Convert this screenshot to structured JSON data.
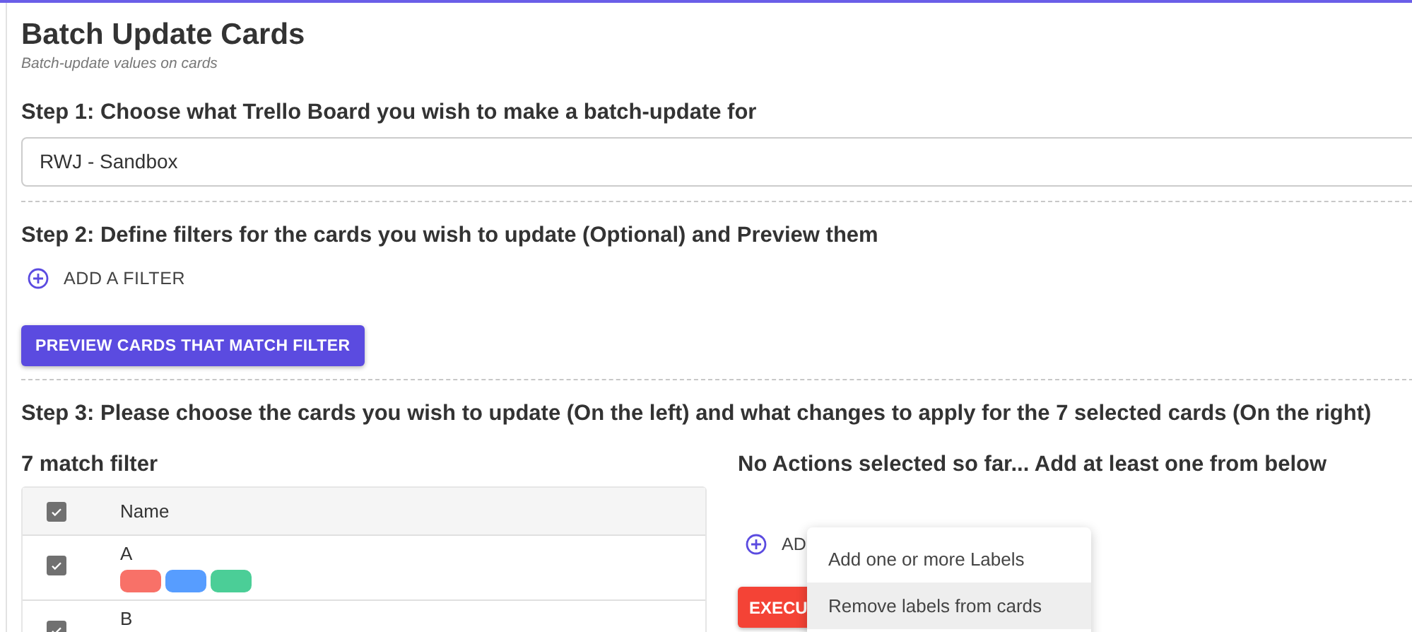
{
  "title": "Batch Update Cards",
  "subtitle": "Batch-update values on cards",
  "step1": {
    "heading": "Step 1: Choose what Trello Board you wish to make a batch-update for",
    "board_value": "RWJ - Sandbox"
  },
  "step2": {
    "heading": "Step 2: Define filters for the cards you wish to update (Optional) and Preview them",
    "add_filter": "ADD A FILTER",
    "preview_button": "PREVIEW CARDS THAT MATCH FILTER"
  },
  "step3": {
    "heading": "Step 3: Please choose the cards you wish to update (On the left) and what changes to apply for the 7 selected cards (On the right)",
    "match_title": "7 match filter",
    "table": {
      "header_checked": true,
      "column": "Name",
      "rows": [
        {
          "name": "A",
          "checked": true,
          "labels": [
            {
              "color": "#f87168"
            },
            {
              "color": "#579dff"
            },
            {
              "color": "#4bce97"
            }
          ]
        },
        {
          "name": "B",
          "checked": true,
          "labels": []
        }
      ]
    },
    "actions_title": "No Actions selected so far... Add at least one from below",
    "add_action": "AD",
    "execute_button": "EXECU",
    "menu": [
      {
        "label": "Add one or more Labels",
        "selected": false
      },
      {
        "label": "Remove labels from cards",
        "selected": true
      }
    ]
  }
}
